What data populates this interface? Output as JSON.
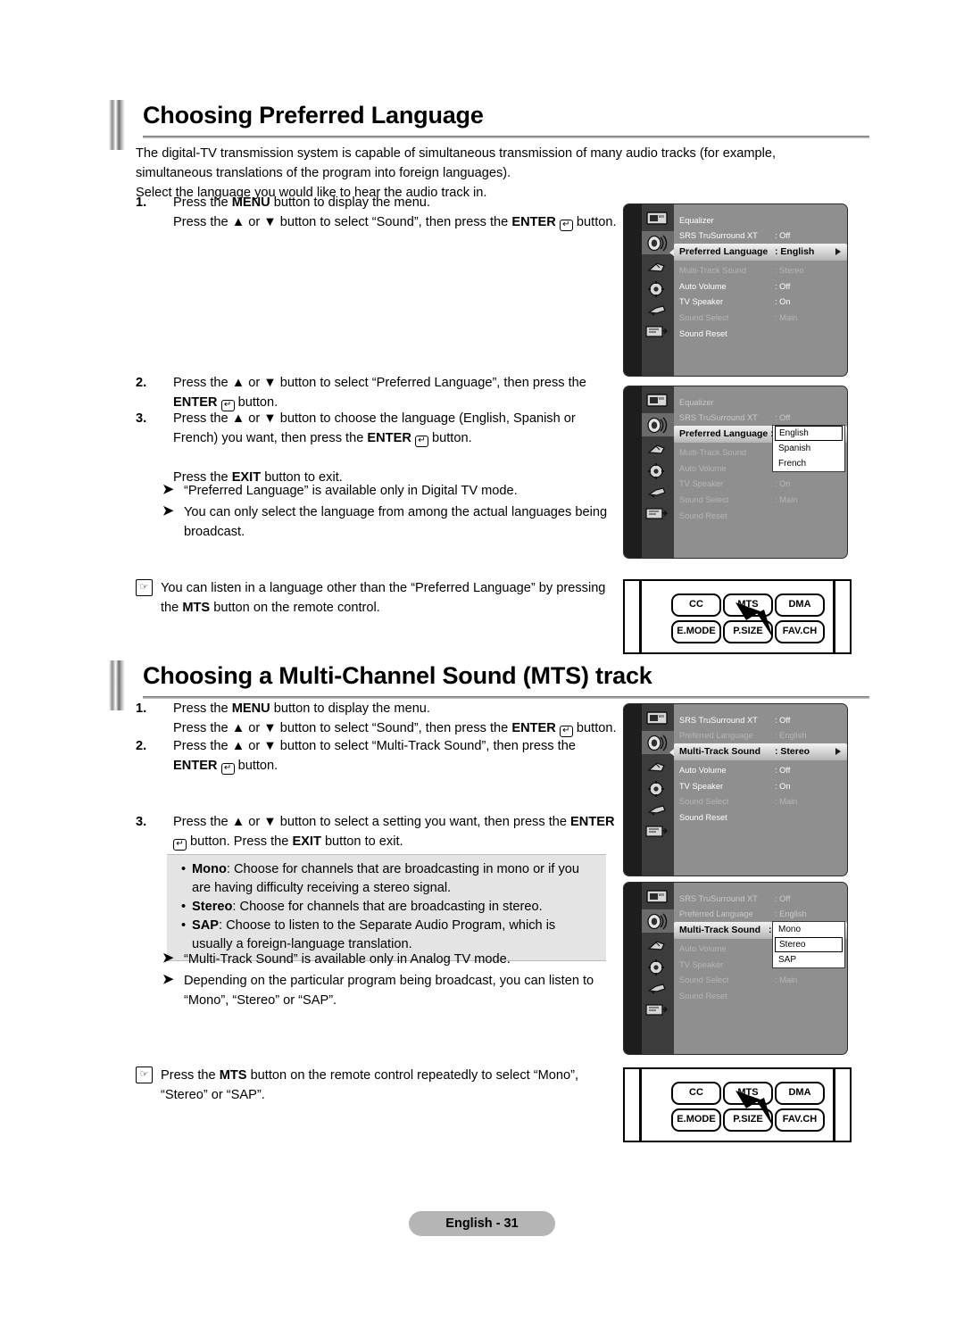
{
  "section1": {
    "heading": "Choosing Preferred Language",
    "intro_line1": "The digital-TV transmission system is capable of simultaneous transmission of many audio tracks (for example,",
    "intro_line2": "simultaneous translations of the program into foreign languages).",
    "intro_line3": "Select the language you would like to hear the audio track in.",
    "steps": [
      {
        "num": "1.",
        "line1_a": "Press the ",
        "line1_b": "MENU",
        "line1_c": " button to display the menu.",
        "line2_a": "Press the ▲ or ▼ button to select “Sound”, then press the ",
        "line2_b": "ENTER",
        "line2_c": " button."
      },
      {
        "num": "2.",
        "line1_a": "Press the ▲ or ▼ button to select “Preferred Language”, then press the",
        "line2_b": "ENTER",
        "line2_c": " button."
      },
      {
        "num": "3.",
        "line1_a": "Press the ▲ or ▼ button to choose the language (English, Spanish or",
        "line2_a": "French) you want, then press the ",
        "line2_b": "ENTER",
        "line2_c": " button.",
        "line3_a": "Press the ",
        "line3_b": "EXIT",
        "line3_c": " button to exit."
      }
    ],
    "notes": [
      "“Preferred Language” is available only in Digital TV mode.",
      "You can only select the language from among the actual languages being broadcast."
    ],
    "tip": {
      "line1": "You can listen in a language other than the “Preferred Language” by pressing",
      "line2_a": "the ",
      "line2_b": "MTS",
      "line2_c": " button on the remote control."
    }
  },
  "section2": {
    "heading": "Choosing a Multi-Channel Sound (MTS) track",
    "steps": [
      {
        "num": "1.",
        "line1_a": "Press the ",
        "line1_b": "MENU",
        "line1_c": " button to display the menu.",
        "line2_a": "Press the ▲ or ▼ button to select “Sound”, then press the ",
        "line2_b": "ENTER",
        "line2_c": " button."
      },
      {
        "num": "2.",
        "line1_a": "Press the ▲ or ▼ button to select “Multi-Track Sound”, then press the",
        "line2_b": "ENTER",
        "line2_c": " button."
      },
      {
        "num": "3.",
        "line1_a": "Press the ▲ or ▼ button to select a setting you want, then press the ",
        "line1_b": "ENTER",
        "line2_c": " button. Press the ",
        "line2_d": "EXIT",
        "line2_e": " button to exit."
      }
    ],
    "modes": [
      {
        "name": "Mono",
        "desc": ": Choose for channels that are broadcasting in mono or if you are having difficulty receiving a stereo signal."
      },
      {
        "name": "Stereo",
        "desc": ": Choose for channels that are broadcasting in stereo."
      },
      {
        "name": "SAP",
        "desc": ": Choose to listen to the Separate Audio Program, which is usually a foreign-language translation."
      }
    ],
    "notes": [
      "“Multi-Track Sound” is available only in Analog TV mode.",
      "Depending on the particular program being broadcast, you can listen to “Mono”, “Stereo” or “SAP”."
    ],
    "tip": {
      "line1_a": "Press the ",
      "line1_b": "MTS",
      "line1_c": " button on the remote control repeatedly to select “Mono”,",
      "line2": "“Stereo” or “SAP”."
    }
  },
  "osd": {
    "tab_label": "Sound",
    "menu1": {
      "rows": [
        {
          "label": "Equalizer",
          "value": "",
          "state": "normal"
        },
        {
          "label": "SRS TruSurround XT",
          "value": ": Off",
          "state": "normal"
        },
        {
          "label": "Preferred Language",
          "value": ": English",
          "state": "selected"
        },
        {
          "label": "Multi-Track Sound",
          "value": ": Stereo",
          "state": "dim"
        },
        {
          "label": "Auto Volume",
          "value": ": Off",
          "state": "normal"
        },
        {
          "label": "TV Speaker",
          "value": ": On",
          "state": "normal"
        },
        {
          "label": "Sound Select",
          "value": ": Main",
          "state": "dim"
        },
        {
          "label": "Sound Reset",
          "value": "",
          "state": "normal"
        }
      ]
    },
    "menu2": {
      "rows": [
        {
          "label": "Equalizer",
          "value": "",
          "state": "dim"
        },
        {
          "label": "SRS TruSurround XT",
          "value": ": Off",
          "state": "dim"
        },
        {
          "label": "Preferred Language :",
          "value": "",
          "state": "selected"
        },
        {
          "label": "Multi-Track Sound",
          "value": ":",
          "state": "dim"
        },
        {
          "label": "Auto Volume",
          "value": ":",
          "state": "dim"
        },
        {
          "label": "TV Speaker",
          "value": ": On",
          "state": "dim"
        },
        {
          "label": "Sound Select",
          "value": ": Main",
          "state": "dim"
        },
        {
          "label": "Sound Reset",
          "value": "",
          "state": "dim"
        }
      ],
      "dropdown": [
        "English",
        "Spanish",
        "French"
      ],
      "dropdown_selected": "English"
    },
    "menu3": {
      "rows": [
        {
          "label": "SRS TruSurround XT",
          "value": ": Off",
          "state": "normal"
        },
        {
          "label": "Preferred Language",
          "value": ": English",
          "state": "dim"
        },
        {
          "label": "Multi-Track Sound",
          "value": ": Stereo",
          "state": "selected"
        },
        {
          "label": "Auto Volume",
          "value": ": Off",
          "state": "normal"
        },
        {
          "label": "TV Speaker",
          "value": ": On",
          "state": "normal"
        },
        {
          "label": "Sound Select",
          "value": ": Main",
          "state": "dim"
        },
        {
          "label": "Sound Reset",
          "value": "",
          "state": "normal"
        }
      ]
    },
    "menu4": {
      "rows": [
        {
          "label": "SRS TruSurround XT",
          "value": ": Off",
          "state": "dim"
        },
        {
          "label": "Preferred Language",
          "value": ": English",
          "state": "dim"
        },
        {
          "label": "Multi-Track Sound",
          "value": ":",
          "state": "selected"
        },
        {
          "label": "Auto Volume",
          "value": ":",
          "state": "dim"
        },
        {
          "label": "TV Speaker",
          "value": ":",
          "state": "dim"
        },
        {
          "label": "Sound Select",
          "value": ": Main",
          "state": "dim"
        },
        {
          "label": "Sound Reset",
          "value": "",
          "state": "dim"
        }
      ],
      "dropdown": [
        "Mono",
        "Stereo",
        "SAP"
      ],
      "dropdown_selected": "Stereo"
    }
  },
  "remote": {
    "buttons_row1": [
      "CC",
      "MTS",
      "DMA"
    ],
    "buttons_row2": [
      "E.MODE",
      "P.SIZE",
      "FAV.CH"
    ]
  },
  "footer": {
    "label": "English - 31"
  }
}
